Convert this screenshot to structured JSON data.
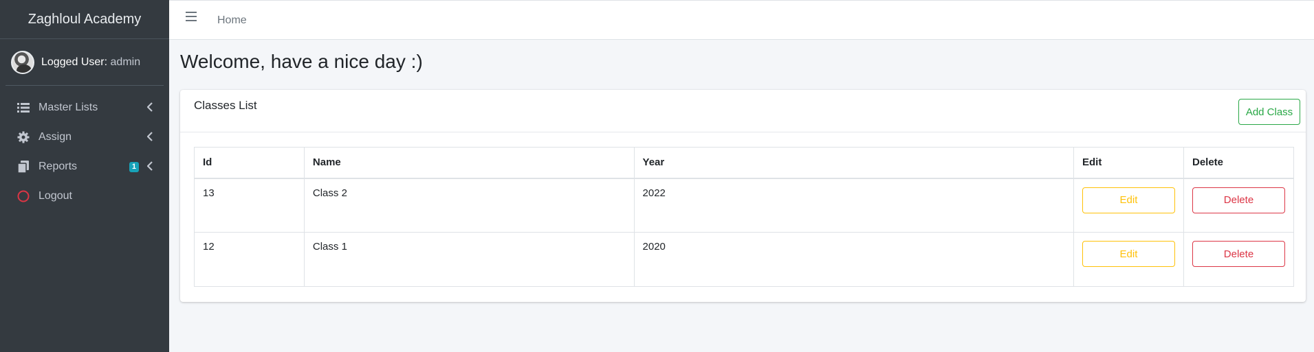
{
  "brand": "Zaghloul Academy",
  "user": {
    "label": "Logged User:",
    "name": "admin"
  },
  "sidebar": {
    "items": [
      {
        "label": "Master Lists",
        "icon": "list-icon"
      },
      {
        "label": "Assign",
        "icon": "gear-icon"
      },
      {
        "label": "Reports",
        "icon": "copy-icon",
        "badge": "1"
      },
      {
        "label": "Logout",
        "icon": "circle-icon"
      }
    ]
  },
  "topbar": {
    "breadcrumb": "Home"
  },
  "page": {
    "title": "Welcome, have a nice day :)"
  },
  "card": {
    "title": "Classes List",
    "add_button": "Add Class",
    "columns": [
      "Id",
      "Name",
      "Year",
      "Edit",
      "Delete"
    ],
    "rows": [
      {
        "id": "13",
        "name": "Class 2",
        "year": "2022",
        "edit": "Edit",
        "delete": "Delete"
      },
      {
        "id": "12",
        "name": "Class 1",
        "year": "2020",
        "edit": "Edit",
        "delete": "Delete"
      }
    ]
  },
  "colors": {
    "sidebar_bg": "#343a40",
    "success": "#28a745",
    "warning": "#ffc107",
    "danger": "#dc3545",
    "info": "#17a2b8",
    "logout_icon": "#dc3545"
  }
}
